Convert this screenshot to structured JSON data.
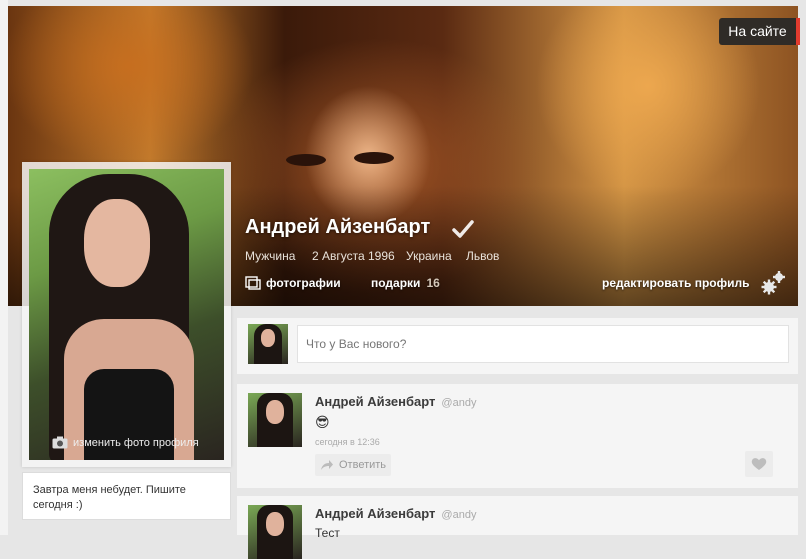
{
  "status": {
    "online": "На сайте"
  },
  "profile": {
    "name": "Андрей Айзенбарт",
    "gender": "Мужчина",
    "birthday": "2 Августа 1996",
    "country": "Украина",
    "city": "Львов"
  },
  "nav": {
    "photos": "фотографии",
    "gifts": "подарки",
    "gifts_count": "16",
    "edit_profile": "редактировать профиль"
  },
  "avatar": {
    "change_photo": "изменить фото профиля"
  },
  "status_text": "Завтра меня небудет. Пишите сегодня :)",
  "compose": {
    "placeholder": "Что у Вас нового?"
  },
  "posts": [
    {
      "author": "Андрей Айзенбарт",
      "handle": "@andy",
      "text": "😎",
      "time": "сегодня в 12:36",
      "reply": "Ответить"
    },
    {
      "author": "Андрей Айзенбарт",
      "handle": "@andy",
      "text": "Тест"
    }
  ],
  "colors": {
    "accent": "#e23b2e",
    "badge_bg": "#2f2b27",
    "panel_bg": "#f5f5f5"
  }
}
